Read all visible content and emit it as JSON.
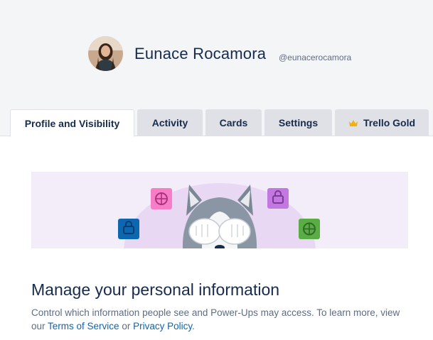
{
  "profile": {
    "name": "Eunace Rocamora",
    "username": "@eunacerocamora"
  },
  "tabs": [
    {
      "label": "Profile and Visibility",
      "active": true
    },
    {
      "label": "Activity",
      "active": false
    },
    {
      "label": "Cards",
      "active": false
    },
    {
      "label": "Settings",
      "active": false
    },
    {
      "label": "Trello Gold",
      "active": false,
      "icon": "crown-icon"
    }
  ],
  "section": {
    "title": "Manage your personal information",
    "desc_prefix": "Control which information people see and Power-Ups may access. To learn more, view our ",
    "terms_link": "Terms of Service",
    "desc_middle": " or ",
    "privacy_link": "Privacy Policy",
    "desc_suffix": "."
  },
  "colors": {
    "header_bg": "#f4f5f7",
    "tab_inactive": "#dfe1e6",
    "banner_bg": "#f3edfa",
    "link": "#0c66b0",
    "crown": "#f2b10f"
  }
}
